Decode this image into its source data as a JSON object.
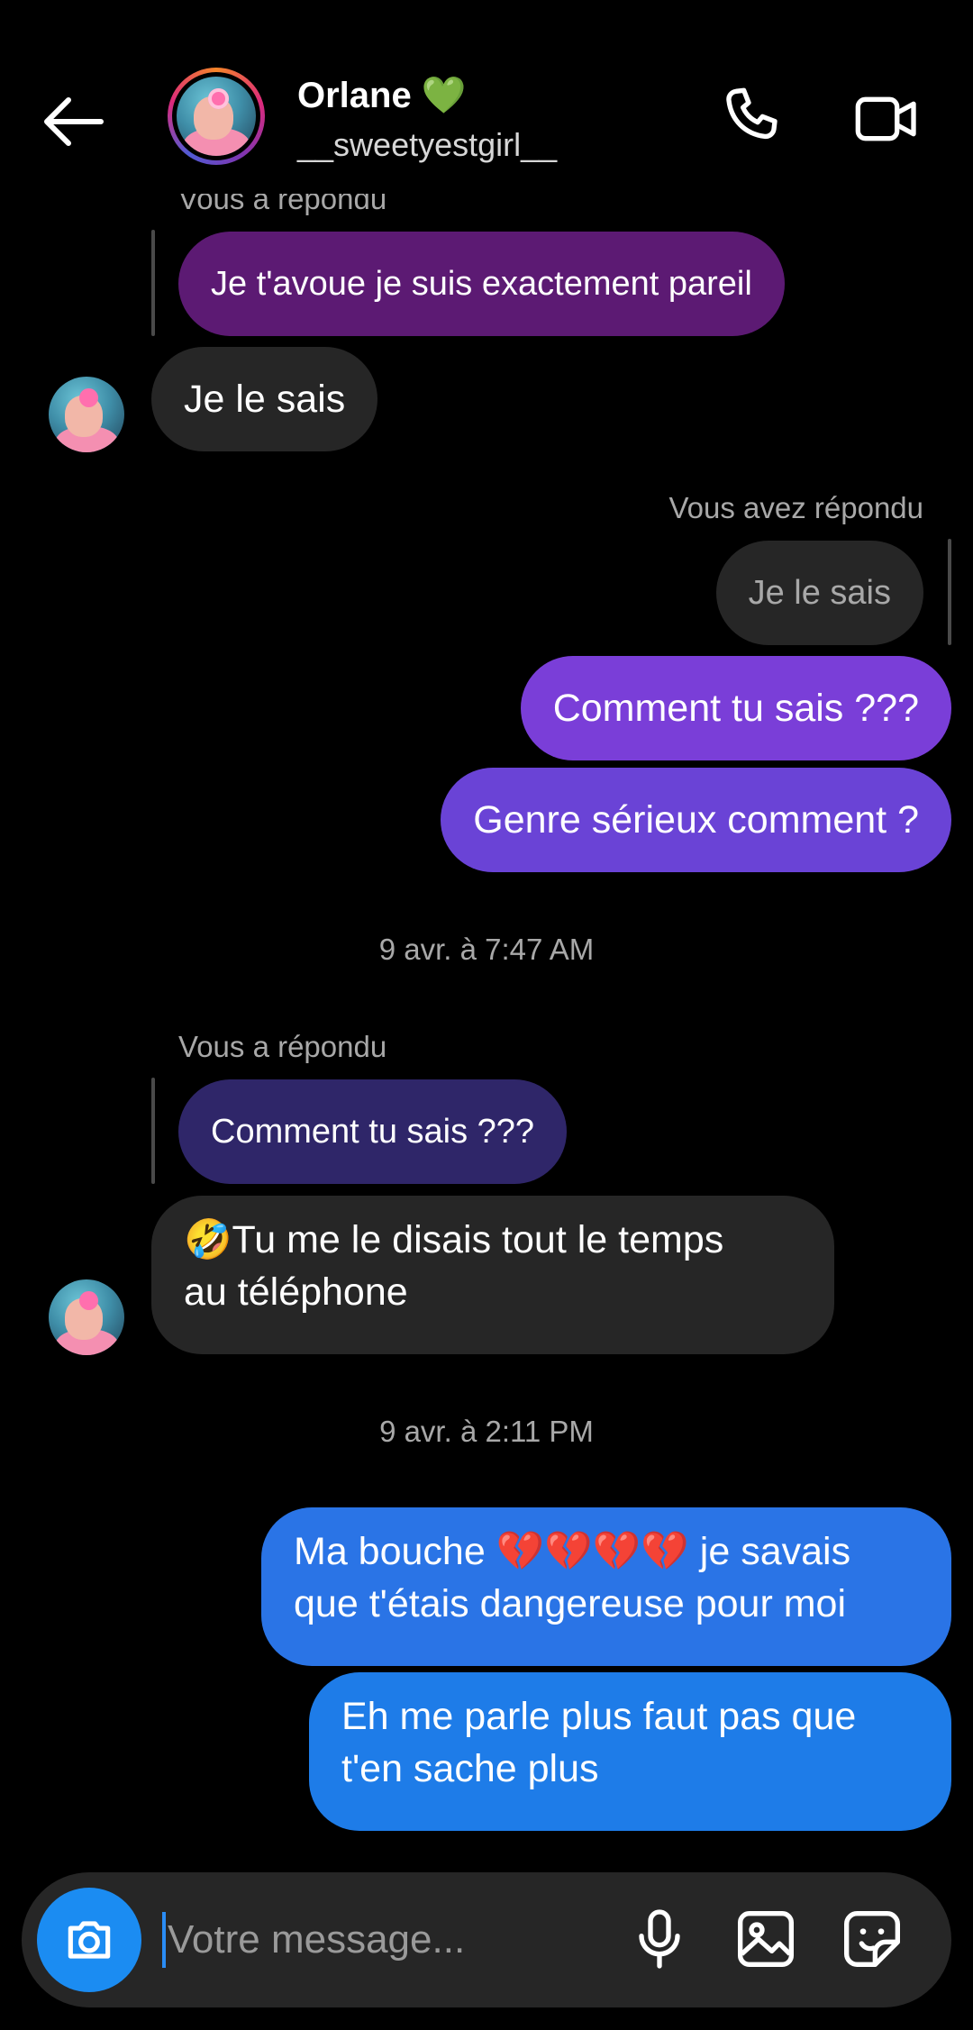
{
  "header": {
    "name": "Orlane 💚",
    "handle": "__sweetyestgirl__",
    "icons": {
      "back": "arrow-left-icon",
      "call": "phone-icon",
      "video": "video-camera-icon"
    }
  },
  "messages": {
    "reply_label_1": "Vous a répondu",
    "quoted_1": "Je t'avoue je suis exactement pareil",
    "incoming_1": "Je le sais",
    "reply_label_2": "Vous avez répondu",
    "quoted_2": "Je le sais",
    "outgoing_1": "Comment tu sais ???",
    "outgoing_2": "Genre sérieux comment ?",
    "timestamp_1": "9 avr. à 7:47 AM",
    "reply_label_3": "Vous a répondu",
    "quoted_3": "Comment tu sais ???",
    "incoming_2_line1": "🤣Tu me le disais tout le temps",
    "incoming_2_line2": "au téléphone",
    "timestamp_2": "9 avr. à 2:11 PM",
    "outgoing_3_line1": "Ma bouche 💔💔💔💔 je savais",
    "outgoing_3_line2": "que t'étais dangereuse pour moi",
    "outgoing_4_line1": "Eh me parle plus faut pas que",
    "outgoing_4_line2": "t'en sache plus"
  },
  "composer": {
    "placeholder": "Votre message...",
    "icons": {
      "camera": "camera-icon",
      "mic": "microphone-icon",
      "gallery": "image-icon",
      "sticker": "sticker-icon"
    }
  },
  "colors": {
    "background": "#000000",
    "incoming_bubble": "#262626",
    "outgoing_purple": "#7a3ed8",
    "outgoing_blue": "#2a74e6",
    "accent": "#1b8cf2"
  }
}
